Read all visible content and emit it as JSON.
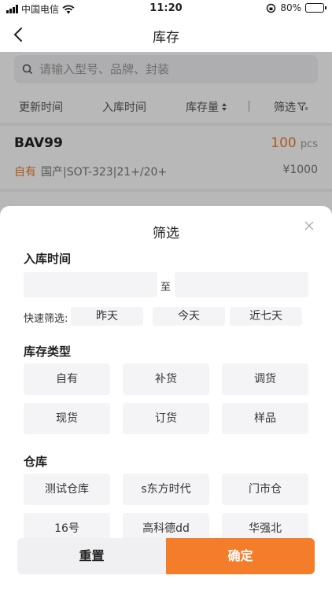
{
  "status": {
    "carrier": "中国电信",
    "time": "11:20",
    "battery": "80%",
    "battery_level": 0.8
  },
  "header": {
    "title": "库存"
  },
  "search": {
    "placeholder": "请输入型号、品牌、封装"
  },
  "sort": {
    "items": [
      "更新时间",
      "入库时间",
      "库存量",
      "筛选"
    ]
  },
  "item": {
    "part": "BAV99",
    "qty": "100",
    "unit": "pcs",
    "tag": "自有",
    "desc": "国产|SOT-323|21+/20+",
    "price": "¥1000"
  },
  "filter": {
    "title": "筛选",
    "date_section": "入库时间",
    "to": "至",
    "quick_label": "快速筛选:",
    "quick": [
      "昨天",
      "今天",
      "近七天"
    ],
    "type_section": "库存类型",
    "types": [
      "自有",
      "补货",
      "调货",
      "现货",
      "订货",
      "样品"
    ],
    "warehouse_section": "仓库",
    "warehouses": [
      "测试仓库",
      "s东方时代",
      "门市仓",
      "16号",
      "高科德dd",
      "华强北"
    ],
    "reset": "重置",
    "confirm": "确定"
  },
  "colors": {
    "accent": "#f47d2c",
    "background": "#f4f4f6"
  },
  "icons": [
    "signal-icon",
    "wifi-icon",
    "orientation-lock-icon",
    "battery-icon",
    "back-icon",
    "search-icon",
    "sort-icon",
    "filter-icon",
    "close-icon"
  ]
}
